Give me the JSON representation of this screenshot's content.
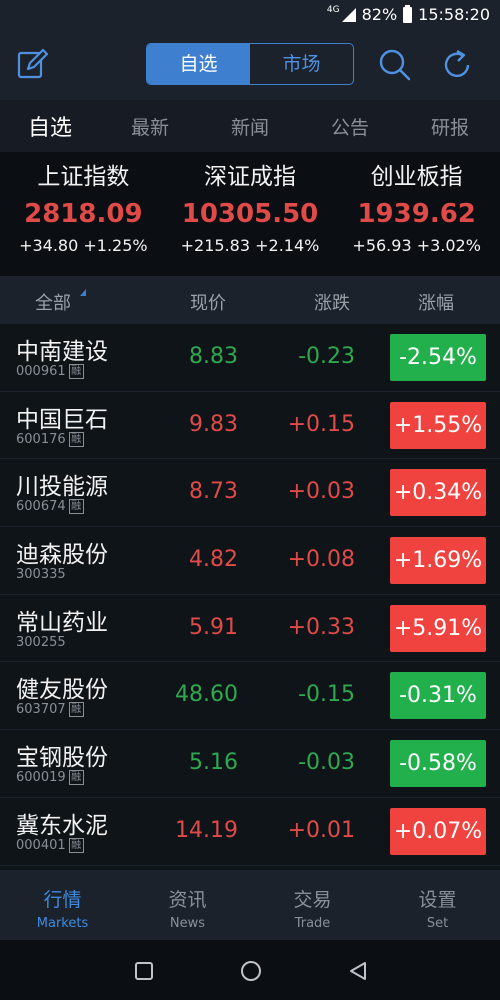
{
  "status": {
    "network": "4G",
    "battery": "82%",
    "time": "15:58:20"
  },
  "topbar": {
    "segments": [
      "自选",
      "市场"
    ],
    "active_segment": 0
  },
  "tabs": [
    {
      "label": "自选",
      "active": true
    },
    {
      "label": "最新",
      "active": false
    },
    {
      "label": "新闻",
      "active": false
    },
    {
      "label": "公告",
      "active": false
    },
    {
      "label": "研报",
      "active": false
    }
  ],
  "indices": [
    {
      "name": "上证指数",
      "value": "2818.09",
      "change": "+34.80 +1.25%"
    },
    {
      "name": "深证成指",
      "value": "10305.50",
      "change": "+215.83 +2.14%"
    },
    {
      "name": "创业板指",
      "value": "1939.62",
      "change": "+56.93 +3.02%"
    }
  ],
  "columns": {
    "all": "全部",
    "price": "现价",
    "change": "涨跌",
    "pct": "涨幅"
  },
  "margin_badge": "融",
  "stocks": [
    {
      "name": "中南建设",
      "code": "000961",
      "price": "8.83",
      "change": "-0.23",
      "pct": "-2.54%",
      "dir": "down",
      "rong": true
    },
    {
      "name": "中国巨石",
      "code": "600176",
      "price": "9.83",
      "change": "+0.15",
      "pct": "+1.55%",
      "dir": "up",
      "rong": true
    },
    {
      "name": "川投能源",
      "code": "600674",
      "price": "8.73",
      "change": "+0.03",
      "pct": "+0.34%",
      "dir": "up",
      "rong": true
    },
    {
      "name": "迪森股份",
      "code": "300335",
      "price": "4.82",
      "change": "+0.08",
      "pct": "+1.69%",
      "dir": "up",
      "rong": false
    },
    {
      "name": "常山药业",
      "code": "300255",
      "price": "5.91",
      "change": "+0.33",
      "pct": "+5.91%",
      "dir": "up",
      "rong": false
    },
    {
      "name": "健友股份",
      "code": "603707",
      "price": "48.60",
      "change": "-0.15",
      "pct": "-0.31%",
      "dir": "down",
      "rong": true
    },
    {
      "name": "宝钢股份",
      "code": "600019",
      "price": "5.16",
      "change": "-0.03",
      "pct": "-0.58%",
      "dir": "down",
      "rong": true
    },
    {
      "name": "冀东水泥",
      "code": "000401",
      "price": "14.19",
      "change": "+0.01",
      "pct": "+0.07%",
      "dir": "up",
      "rong": true
    }
  ],
  "bottom_nav": [
    {
      "cn": "行情",
      "en": "Markets",
      "active": true
    },
    {
      "cn": "资讯",
      "en": "News",
      "active": false
    },
    {
      "cn": "交易",
      "en": "Trade",
      "active": false
    },
    {
      "cn": "设置",
      "en": "Set",
      "active": false
    }
  ],
  "colors": {
    "up": "#e04a48",
    "down": "#2fa84f",
    "accent": "#3f7fd0"
  },
  "icons": [
    "edit-icon",
    "search-icon",
    "refresh-icon",
    "signal-icon",
    "battery-icon",
    "sort-triangle-icon",
    "home-square-icon",
    "home-circle-icon",
    "back-triangle-icon"
  ]
}
